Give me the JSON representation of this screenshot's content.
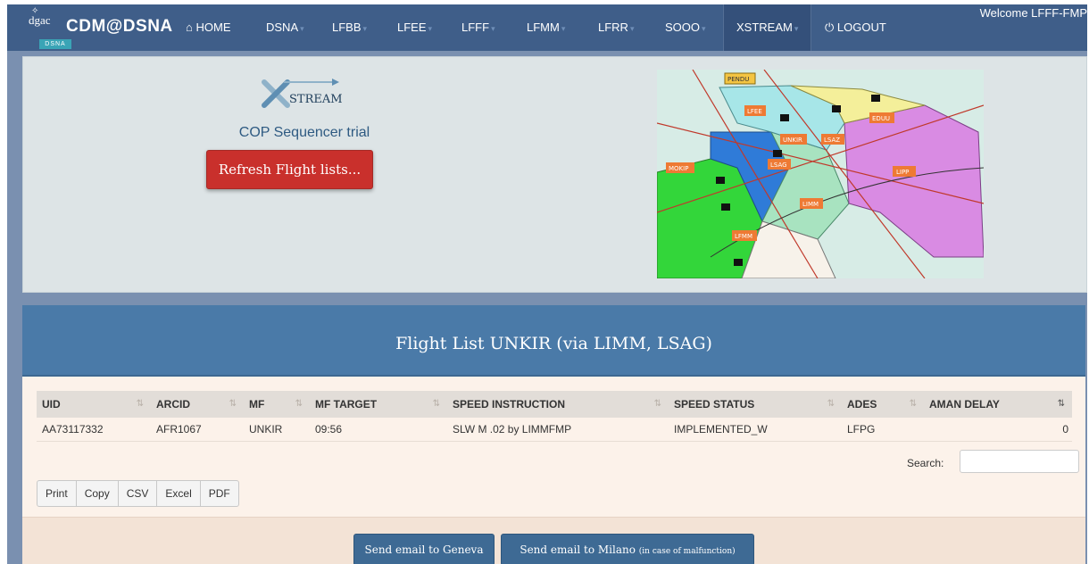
{
  "brand": {
    "logo_text": "dgac",
    "logo_sub": "DSNA",
    "title": "CDM@DSNA"
  },
  "nav": {
    "items": [
      {
        "label": "HOME",
        "icon": "home-icon"
      },
      {
        "label": "DSNA"
      },
      {
        "label": "LFBB"
      },
      {
        "label": "LFEE"
      },
      {
        "label": "LFFF"
      },
      {
        "label": "LFMM"
      },
      {
        "label": "LFRR"
      },
      {
        "label": "SOOO"
      },
      {
        "label": "XSTREAM",
        "active": true
      },
      {
        "label": "LOGOUT",
        "icon": "power-icon"
      }
    ],
    "welcome": "Welcome LFFF-FMP"
  },
  "xstream": {
    "logo_text": "STREAM",
    "subtitle": "COP Sequencer trial",
    "refresh_label": "Refresh Flight lists..."
  },
  "map": {
    "labels": [
      "PENDU",
      "UNKIR",
      "LFEE",
      "EDUU",
      "LSAZ",
      "LSAG",
      "MOKIP",
      "LIPP",
      "LIMM",
      "LFMM"
    ]
  },
  "flight_list": {
    "title": "Flight List UNKIR (via LIMM, LSAG)",
    "columns": [
      "UID",
      "ARCID",
      "MF",
      "MF TARGET",
      "SPEED INSTRUCTION",
      "SPEED STATUS",
      "ADES",
      "AMAN DELAY"
    ],
    "rows": [
      [
        "AA73117332",
        "AFR1067",
        "UNKIR",
        "09:56",
        "SLW M .02 by LIMMFMP",
        "IMPLEMENTED_W",
        "LFPG",
        "0"
      ]
    ],
    "search_label": "Search:",
    "search_value": "",
    "export_buttons": [
      "Print",
      "Copy",
      "CSV",
      "Excel",
      "PDF"
    ]
  },
  "actions": {
    "geneva_label": "Send email to Geneva",
    "milano_label": "Send email to Milano",
    "milano_note": "(in case of malfunction)"
  },
  "colors": {
    "navbar": "#3f5e89",
    "refresh_button": "#c9302c",
    "panel_header": "#4a7aa8",
    "mail_button": "#3e6a94"
  }
}
